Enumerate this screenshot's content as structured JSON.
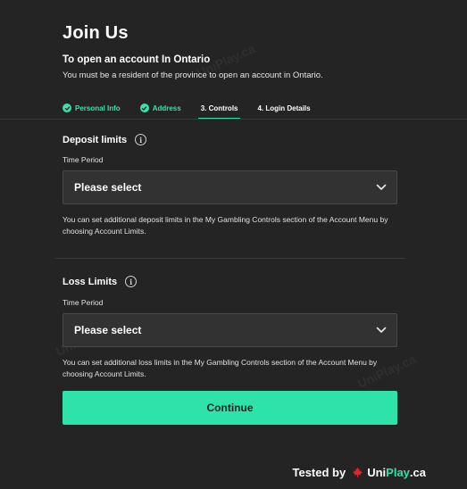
{
  "header": {
    "title": "Join Us",
    "subtitle": "To open an account In Ontario",
    "note": "You must be a resident of the province to open an account in Ontario."
  },
  "steps": [
    {
      "label": "Personal Info",
      "state": "done"
    },
    {
      "label": "Address",
      "state": "done"
    },
    {
      "label": "3. Controls",
      "state": "current"
    },
    {
      "label": "4. Login Details",
      "state": "todo"
    }
  ],
  "deposit": {
    "title": "Deposit limits",
    "field_label": "Time Period",
    "selected": "Please select",
    "helper": "You can set additional deposit limits in the My Gambling Controls section of the Account Menu by choosing Account Limits."
  },
  "loss": {
    "title": "Loss Limits",
    "field_label": "Time Period",
    "selected": "Please select",
    "helper": "You can set additional loss limits in the My Gambling Controls section of the Account Menu by choosing Account Limits."
  },
  "actions": {
    "continue_label": "Continue"
  },
  "badge": {
    "prefix": "Tested by",
    "brand_uni": "Uni",
    "brand_play": "Play",
    "brand_tld": ".ca"
  },
  "watermark": {
    "text": "UniPlay.ca"
  },
  "icons": {
    "step_done": "check-circle-icon",
    "info": "info-icon",
    "dropdown": "chevron-down-icon",
    "brand_leaf": "maple-leaf-icon"
  },
  "colors": {
    "background": "#242424",
    "accent": "#2de3a9",
    "input_bg": "#323232",
    "brand_leaf": "#e0262b"
  }
}
